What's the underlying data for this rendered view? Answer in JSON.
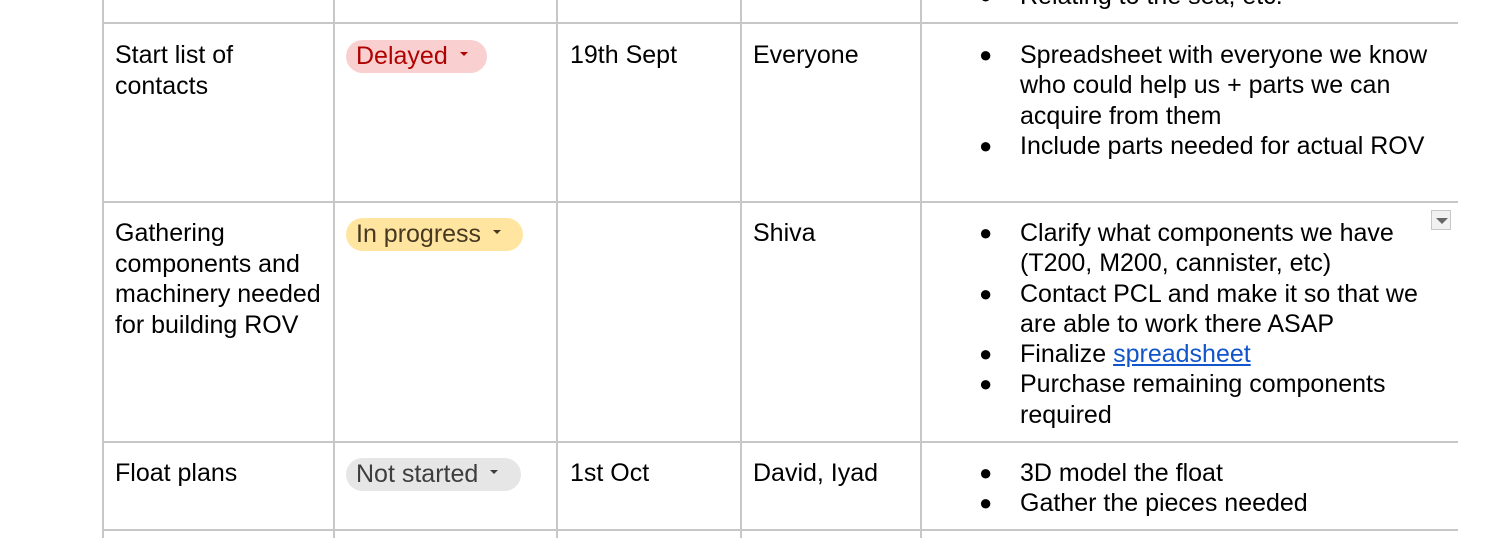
{
  "top_row": {
    "notes_partial": "Relating to the sea, etc."
  },
  "rows": [
    {
      "task": "Start list of contacts",
      "status": {
        "label": "Delayed",
        "bg": "#f9cfcf",
        "fg": "#b10202"
      },
      "date": "19th Sept",
      "owner": "Everyone",
      "notes": [
        "Spreadsheet with everyone we know who could help us + parts we can acquire from them",
        "Include parts needed for actual ROV"
      ]
    },
    {
      "task": "Gathering components and machinery needed for building ROV",
      "status": {
        "label": "In progress",
        "bg": "#ffe5a0",
        "fg": "#473821"
      },
      "date": "",
      "owner": "Shiva",
      "notes": [
        "Clarify what components we have (T200, M200, cannister, etc)",
        "Contact PCL and make it so that we are able to work there ASAP"
      ],
      "finalize_prefix": "Finalize ",
      "finalize_link": "spreadsheet",
      "notes_after": [
        "Purchase remaining components required"
      ]
    },
    {
      "task": "Float plans",
      "status": {
        "label": "Not started",
        "bg": "#e6e6e6",
        "fg": "#3d3d3d"
      },
      "date": "1st Oct",
      "owner": "David, Iyad",
      "notes": [
        "3D model the float",
        "Gather the pieces needed"
      ]
    }
  ],
  "bullet_glyph": "●",
  "icons": {
    "status_caret": "chevron-down-icon",
    "cell_dropdown": "dropdown-arrow-icon"
  }
}
